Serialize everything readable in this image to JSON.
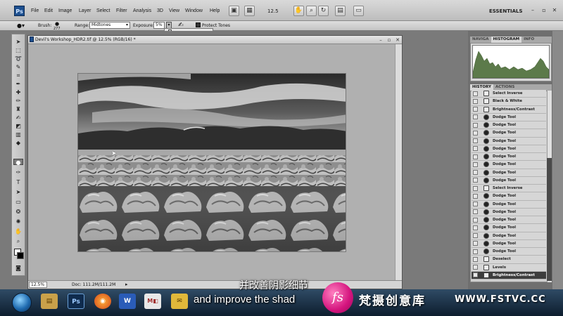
{
  "menubar": {
    "logo": "Ps",
    "items": [
      "File",
      "Edit",
      "Image",
      "Layer",
      "Select",
      "Filter",
      "Analysis",
      "3D",
      "View",
      "Window",
      "Help"
    ],
    "zoom": "12.5",
    "workspace": "ESSENTIALS"
  },
  "options_bar": {
    "brush_label": "Brush:",
    "brush_size": "277",
    "range_label": "Range:",
    "range_value": "Midtones",
    "exposure_label": "Exposure:",
    "exposure_value": "5%",
    "protect_tones_label": "Protect Tones",
    "protect_tones_checked": true
  },
  "document": {
    "title": "Devil's Workshop_HDR2.tif @ 12.5% (RGB/16) *",
    "zoom": "12.5%",
    "info": "Doc: 111.2M/111.2M"
  },
  "panels": {
    "top_tabs": [
      "NAVIGA",
      "HISTOGRAM",
      "INFO"
    ],
    "top_selected": "HISTOGRAM",
    "history_tabs": [
      "HISTORY",
      "ACTIONS"
    ],
    "history_selected": "HISTORY",
    "history_items": [
      {
        "label": "Select Inverse",
        "icon": "doc"
      },
      {
        "label": "Black & White",
        "icon": "doc"
      },
      {
        "label": "Brightness/Contrast",
        "icon": "doc"
      },
      {
        "label": "Dodge Tool",
        "icon": "dodge"
      },
      {
        "label": "Dodge Tool",
        "icon": "dodge"
      },
      {
        "label": "Dodge Tool",
        "icon": "dodge"
      },
      {
        "label": "Dodge Tool",
        "icon": "dodge"
      },
      {
        "label": "Dodge Tool",
        "icon": "dodge"
      },
      {
        "label": "Dodge Tool",
        "icon": "dodge"
      },
      {
        "label": "Dodge Tool",
        "icon": "dodge"
      },
      {
        "label": "Dodge Tool",
        "icon": "dodge"
      },
      {
        "label": "Dodge Tool",
        "icon": "dodge"
      },
      {
        "label": "Select Inverse",
        "icon": "doc"
      },
      {
        "label": "Dodge Tool",
        "icon": "dodge"
      },
      {
        "label": "Dodge Tool",
        "icon": "dodge"
      },
      {
        "label": "Dodge Tool",
        "icon": "dodge"
      },
      {
        "label": "Dodge Tool",
        "icon": "dodge"
      },
      {
        "label": "Dodge Tool",
        "icon": "dodge"
      },
      {
        "label": "Dodge Tool",
        "icon": "dodge"
      },
      {
        "label": "Dodge Tool",
        "icon": "dodge"
      },
      {
        "label": "Dodge Tool",
        "icon": "dodge"
      },
      {
        "label": "Deselect",
        "icon": "doc"
      },
      {
        "label": "Levels",
        "icon": "doc"
      },
      {
        "label": "Brightness/Contrast",
        "icon": "doc",
        "selected": true
      }
    ]
  },
  "taskbar": {
    "apps": [
      "windows-explorer",
      "photoshop",
      "firefox",
      "word",
      "media",
      "outlook"
    ],
    "ps_label": "Ps",
    "word_label": "W"
  },
  "overlay": {
    "subtitle_cn": "并改善阴影细节",
    "subtitle_en": "and improve the shad",
    "watermark_logo": "fs",
    "watermark_brand": "梵摄创意库",
    "watermark_url": "WWW.FSTVC.CC"
  },
  "colors": {
    "accent_pink": "#d4147e",
    "histogram_fill": "#5c7a4a",
    "selected_row": "#3d3d3d"
  }
}
